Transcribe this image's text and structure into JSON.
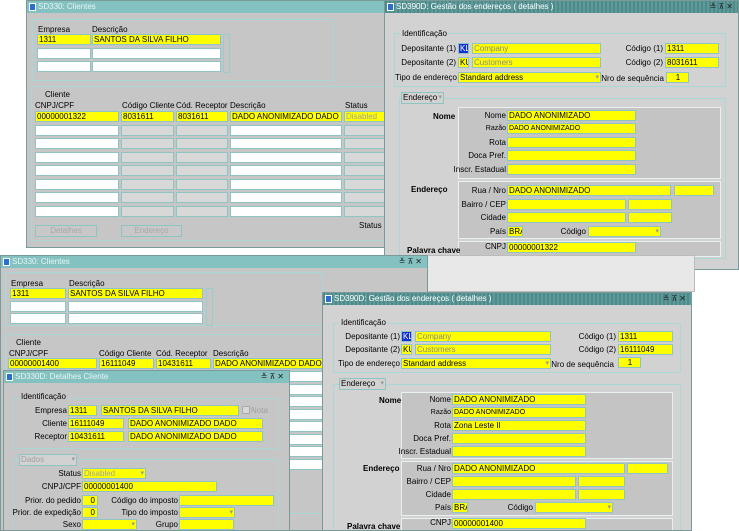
{
  "clientes_top": {
    "title": "SD330: Clientes",
    "empresa_label": "Empresa",
    "descricao_label": "Descrição",
    "empresa": "1311",
    "descricao": "SANTOS DA SILVA FILHO",
    "cliente_label": "Cliente",
    "headers": [
      "CNPJ/CPF",
      "Código Cliente",
      "Cód. Receptor",
      "Descrição",
      "Status"
    ],
    "row": [
      "00000001322",
      "8031611",
      "8031611",
      "DADO ANONIMIZADO DADO ANON",
      "Disabled"
    ],
    "detalhes_button": "Detalhes",
    "endereco_button": "Endereço",
    "status_label": "Status"
  },
  "enderecos_top": {
    "title": "SD390D: Gestão dos endereços ( detalhes )",
    "identificacao": "Identificação",
    "dep1_label": "Depositante (1)",
    "dep1_code": "KL",
    "dep1": "Company",
    "cod1_label": "Código (1)",
    "cod1": "1311",
    "dep2_label": "Depositante (2)",
    "dep2_code": "KU",
    "dep2": "Customers",
    "cod2_label": "Código (2)",
    "cod2": "8031611",
    "tipo_label": "Tipo de endereço",
    "tipo": "Standard address",
    "nro_label": "Nro de sequência",
    "nro": "1",
    "endereco_tab": "Endereço",
    "nome_section": "Nome",
    "nome_label": "Nome",
    "nome": "DADO ANONIMIZADO",
    "razao_label": "Razão",
    "razao": "DADO ANONIMIZADO",
    "rota_label": "Rota",
    "rota": "",
    "doca_label": "Doca Pref.",
    "inscr_label": "Inscr. Estadual",
    "endereco_section": "Endereço",
    "rua_label": "Rua / Nro",
    "rua": "DADO ANONIMIZADO",
    "bairro_label": "Bairro / CEP",
    "cidade_label": "Cidade",
    "pais_label": "País",
    "pais": "BRA",
    "codigo_label": "Código",
    "palavra_section": "Palavra chave",
    "cnpj_label": "CNPJ",
    "cnpj": "00000001322"
  },
  "clientes_bottom": {
    "title": "SD330: Clientes",
    "empresa_label": "Empresa",
    "descricao_label": "Descrição",
    "empresa": "1311",
    "descricao": "SANTOS DA SILVA FILHO",
    "cliente_label": "Cliente",
    "headers": [
      "CNPJ/CPF",
      "Código Cliente",
      "Cód. Receptor",
      "Descrição"
    ],
    "row": [
      "00000001400",
      "16111049",
      "10431611",
      "DADO ANONIMIZADO DADO ANO"
    ]
  },
  "detalhes": {
    "title": "SD330D: Detalhes Cliente",
    "identificacao": "Identificação",
    "empresa_label": "Empresa",
    "empresa": "1311",
    "empresa_desc": "SANTOS DA SILVA FILHO",
    "nota_label": "Nota",
    "cliente_label": "Cliente",
    "cliente": "16111049",
    "cliente_desc": "DADO ANONIMIZADO DADO ANONIMIZA",
    "receptor_label": "Receptor",
    "receptor": "10431611",
    "receptor_desc": "DADO ANONIMIZADO DADO ANONIMIZA",
    "dados_tab": "Dados",
    "status_label": "Status",
    "status": "Disabled",
    "cnpj_label": "CNPJ/CPF",
    "cnpj": "00000001400",
    "prior_pedido_label": "Prior. do pedido",
    "prior_pedido": "0",
    "cod_imposto_label": "Código do imposto",
    "prior_exp_label": "Prior. de expedição",
    "prior_exp": "0",
    "tipo_imposto_label": "Tipo do imposto",
    "sexo_label": "Sexo",
    "grupo_label": "Grupo"
  },
  "enderecos_bottom": {
    "title": "SD390D: Gestão dos endereços ( detalhes )",
    "identificacao": "Identificação",
    "dep1_label": "Depositante (1)",
    "dep1_code": "KL",
    "dep1": "Company",
    "cod1_label": "Código (1)",
    "cod1": "1311",
    "dep2_label": "Depositante (2)",
    "dep2_code": "KU",
    "dep2": "Customers",
    "cod2_label": "Código (2)",
    "cod2": "16111049",
    "tipo_label": "Tipo de endereço",
    "tipo": "Standard address",
    "nro_label": "Nro de sequência",
    "nro": "1",
    "endereco_tab": "Endereço",
    "nome_section": "Nome",
    "nome_label": "Nome",
    "nome": "DADO ANONIMIZADO",
    "razao_label": "Razão",
    "razao": "DADO ANONIMIZADO",
    "rota_label": "Rota",
    "rota": "Zona Leste II",
    "doca_label": "Doca Pref.",
    "inscr_label": "Inscr. Estadual",
    "endereco_section": "Endereço",
    "rua_label": "Rua / Nro",
    "rua": "DADO ANONIMIZADO",
    "bairro_label": "Bairro / CEP",
    "cidade_label": "Cidade",
    "pais_label": "País",
    "pais": "BRA",
    "codigo_label": "Código",
    "palavra_section": "Palavra chave",
    "cnpj_label": "CNPJ",
    "cnpj": "00000001400"
  },
  "title_buttons": "≚⊼✕"
}
